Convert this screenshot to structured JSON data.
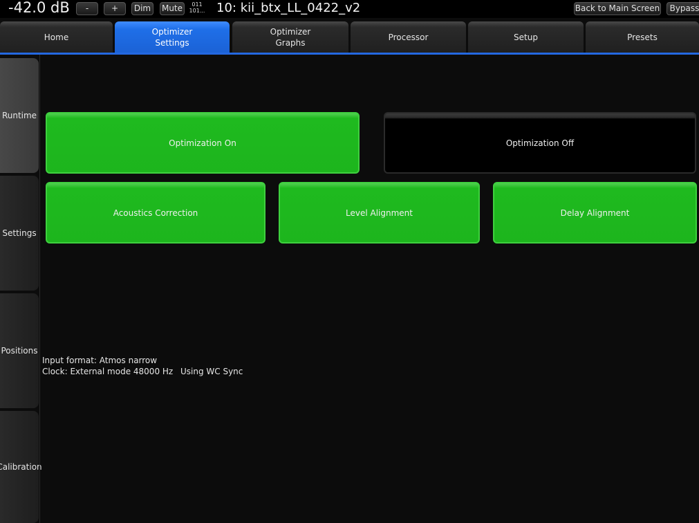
{
  "header": {
    "volume": "-42.0 dB",
    "minus_label": "-",
    "plus_label": "+",
    "dim_label": "Dim",
    "mute_label": "Mute",
    "bits_top": "011",
    "bits_bottom": "101...",
    "preset_name": "10: kii_btx_LL_0422_v2",
    "back_label": "Back to Main Screen",
    "bypass_label": "Bypass"
  },
  "tabs": [
    {
      "label": "Home"
    },
    {
      "label": "Optimizer\nSettings",
      "active": true
    },
    {
      "label": "Optimizer\nGraphs"
    },
    {
      "label": "Processor"
    },
    {
      "label": "Setup"
    },
    {
      "label": "Presets"
    }
  ],
  "sidenav": [
    {
      "label": "Runtime",
      "active": true
    },
    {
      "label": "Settings"
    },
    {
      "label": "Positions"
    },
    {
      "label": "Calibration"
    }
  ],
  "main": {
    "optimization_on": "Optimization On",
    "optimization_off": "Optimization Off",
    "acoustics_correction": "Acoustics Correction",
    "level_alignment": "Level Alignment",
    "delay_alignment": "Delay Alignment"
  },
  "status": {
    "input_format": "Input format: Atmos narrow",
    "clock": "Clock: External mode 48000 Hz",
    "sync": "Using WC Sync"
  },
  "colors": {
    "accent_blue": "#1f6fe8",
    "active_green": "#1db51d",
    "background": "#0c0c0c"
  }
}
